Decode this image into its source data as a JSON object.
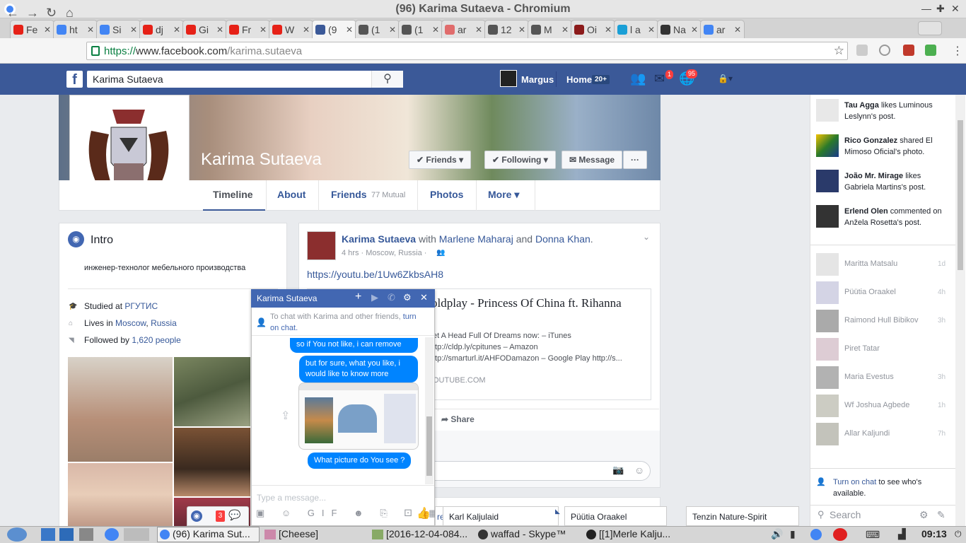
{
  "window": {
    "title": "(96) Karima Sutaeva - Chromium"
  },
  "tabs": [
    {
      "label": "Fe",
      "icon": "youtube-icon",
      "color": "#e62117"
    },
    {
      "label": "ht",
      "icon": "google-icon",
      "color": "#4285f4"
    },
    {
      "label": "Si",
      "icon": "google-icon",
      "color": "#4285f4"
    },
    {
      "label": "dj",
      "icon": "youtube-icon",
      "color": "#e62117"
    },
    {
      "label": "Gi",
      "icon": "youtube-icon",
      "color": "#e62117"
    },
    {
      "label": "Fr",
      "icon": "youtube-icon",
      "color": "#e62117"
    },
    {
      "label": "W",
      "icon": "youtube-icon",
      "color": "#e62117"
    },
    {
      "label": "(9",
      "icon": "facebook-icon",
      "color": "#3b5998"
    },
    {
      "label": "(1",
      "icon": "briefcase-icon",
      "color": "#555555"
    },
    {
      "label": "(1",
      "icon": "briefcase-icon",
      "color": "#555555"
    },
    {
      "label": "ar",
      "icon": "heart-icon",
      "color": "#e06c6c"
    },
    {
      "label": "12",
      "icon": "briefcase-icon",
      "color": "#555555"
    },
    {
      "label": "M",
      "icon": "briefcase-icon",
      "color": "#555555"
    },
    {
      "label": "Oi",
      "icon": "odnoklassniki-icon",
      "color": "#8b1a1a"
    },
    {
      "label": "l a",
      "icon": "snowflake-icon",
      "color": "#1a9fd6"
    },
    {
      "label": "Na",
      "icon": "wikipedia-icon",
      "color": "#333333"
    },
    {
      "label": "ar",
      "icon": "google-icon",
      "color": "#4285f4"
    }
  ],
  "address": {
    "https": "https://",
    "host": "www.facebook.com",
    "path": "/karima.sutaeva"
  },
  "fb": {
    "search_value": "Karima Sutaeva",
    "user_name": "Margus",
    "home_label": "Home",
    "home_count": "20+",
    "messages_badge": "1",
    "notif_badge": "95"
  },
  "profile": {
    "name": "Karima Sutaeva",
    "friends_btn": "Friends",
    "following_btn": "Following",
    "message_btn": "Message",
    "more_dots": "···",
    "nav": {
      "timeline": "Timeline",
      "about": "About",
      "friends": "Friends",
      "mutual": "77 Mutual",
      "photos": "Photos",
      "more": "More"
    }
  },
  "intro": {
    "title": "Intro",
    "bio": "инженер-технолог мебельного производства",
    "studied_prefix": "Studied at ",
    "studied_place": "РГУТИС",
    "lives_prefix": "Lives in ",
    "lives_city": "Moscow",
    "lives_country": "Russia",
    "followed_prefix": "Followed by ",
    "followed_count": "1,620 people"
  },
  "post": {
    "author": "Karima Sutaeva",
    "with_word": "with",
    "tagged1": "Marlene Maharaj",
    "and_word": "and",
    "tagged2": "Donna Khan",
    "meta": "4 hrs · Moscow, Russia ·",
    "link": "https://youtu.be/1Uw6ZkbsAH8",
    "preview_title": "oldplay - Princess Of China ft. Rihanna",
    "preview_desc1": "et A Head Full Of Dreams now: – iTunes",
    "preview_desc2": "ttp://cldp.ly/cpitunes – Amazon",
    "preview_desc3": "ttp://smarturl.it/AHFODamazon – Google Play http://s...",
    "preview_domain": "OUTUBE.COM",
    "share_label": "Share"
  },
  "chat": {
    "name": "Karima Sutaeva",
    "notice_text": "To chat with Karima and other friends,",
    "notice_link": "turn on chat.",
    "msg1": "so if You not like, i can remove",
    "msg2": "but for sure, what you like, i would like to know more",
    "msg3": "What picture do You see ?",
    "input_placeholder": "Type a message...",
    "tools": "▣ ☺ GIF ☻ ⎘ ⚀ ▦"
  },
  "ticker": [
    {
      "name": "Tau Agga",
      "text": " likes Luminous Leslynn's post."
    },
    {
      "name": "Rico Gonzalez",
      "text": " shared El Mimoso Oficial's photo."
    },
    {
      "name": "João Mr. Mirage",
      "text": " likes Gabriela Martins's post."
    },
    {
      "name": "Erlend Olen",
      "text": " commented on Anžela Rosetta's post."
    }
  ],
  "chat_friends": [
    {
      "name": "Maritta Matsalu",
      "time": "1d"
    },
    {
      "name": "Püütia Oraakel",
      "time": "4h"
    },
    {
      "name": "Raimond Hull Bibikov",
      "time": "3h"
    },
    {
      "name": "Piret Tatar",
      "time": ""
    },
    {
      "name": "Maria Evestus",
      "time": "3h"
    },
    {
      "name": "Wf Joshua Agbede",
      "time": "1h"
    },
    {
      "name": "Allar Kaljundi",
      "time": "7h"
    }
  ],
  "sidebar_footer": {
    "link": "Turn on chat",
    "text": " to see who's available.",
    "search": "Search"
  },
  "chat_tabs": [
    "Karl Kaljulaid",
    "Püütia Oraakel",
    "Tenzin Nature-Spirit"
  ],
  "dock_badge": "3",
  "taskbar": {
    "items": [
      "(96) Karima Sut...",
      "[Cheese]",
      "[2016-12-04-084...",
      "waffad - Skype™",
      "[[1]Merle Kalju..."
    ],
    "clock": "09:13"
  }
}
